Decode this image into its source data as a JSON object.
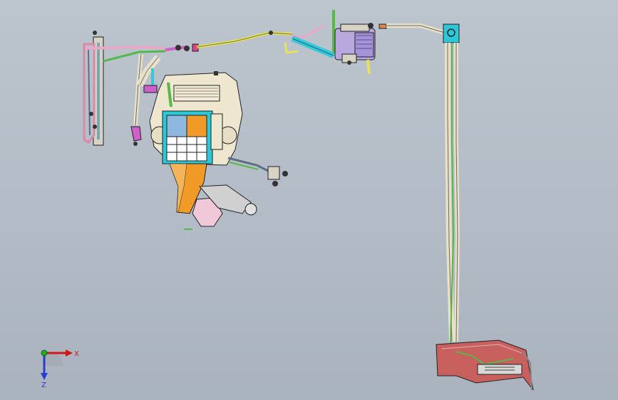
{
  "viewport": {
    "background_top": "#bcc4cd",
    "background_bottom": "#aab3bd"
  },
  "colors": {
    "pipe_yellow": "#e6e05a",
    "pipe_green": "#56b84a",
    "pipe_cyan": "#34c8d8",
    "pipe_pink": "#e8a8c8",
    "pipe_cream": "#e8e0c8",
    "duct_orange": "#f29a28",
    "duct_blue": "#8fb8e0",
    "housing_cream": "#efe6cf",
    "console_red": "#c8605e",
    "outline": "#1e2226"
  },
  "triad": {
    "x_label": "X",
    "z_label": "Z",
    "icon": "coordinate-triad-icon"
  }
}
